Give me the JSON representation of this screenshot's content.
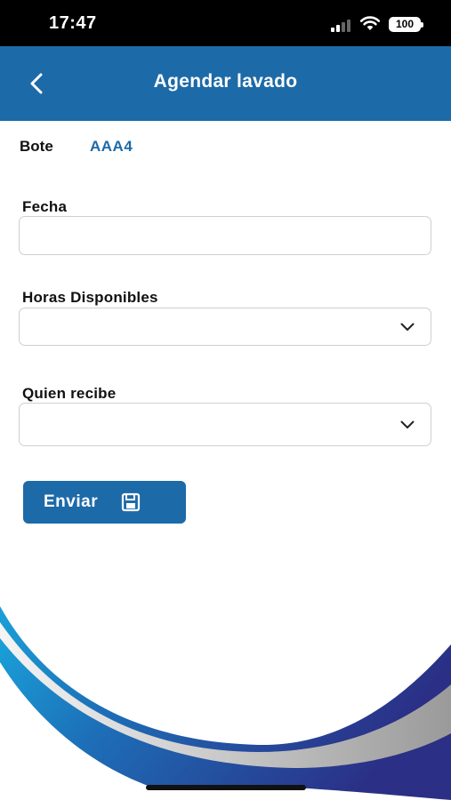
{
  "status_bar": {
    "time": "17:47",
    "battery": "100"
  },
  "header": {
    "title": "Agendar lavado"
  },
  "boat": {
    "label": "Bote",
    "value": "AAA4"
  },
  "form": {
    "date": {
      "label": "Fecha",
      "value": ""
    },
    "hours": {
      "label": "Horas Disponibles",
      "selected": ""
    },
    "receiver": {
      "label": "Quien recibe",
      "selected": ""
    }
  },
  "submit": {
    "label": "Enviar",
    "icon": "save-icon"
  },
  "colors": {
    "primary": "#1d6aa8",
    "dark_blue": "#2b2f86",
    "light_blue": "#1aa0d8"
  }
}
